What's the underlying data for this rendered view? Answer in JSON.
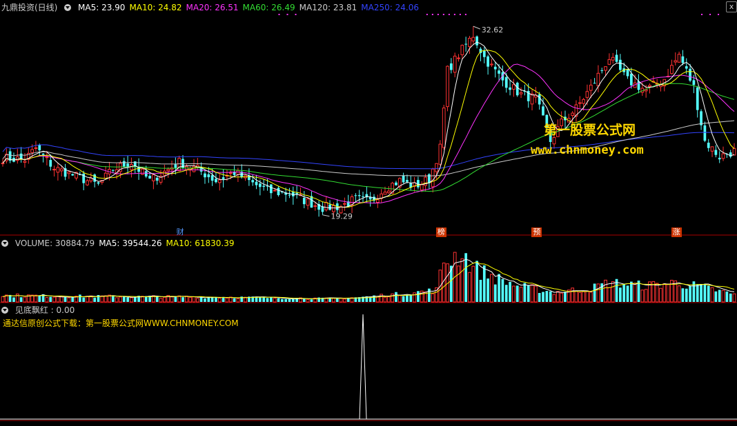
{
  "main_header": {
    "title": "九鼎投资(日线)",
    "ma_labels": [
      {
        "text": "MA5: 23.90",
        "color": "#ffffff"
      },
      {
        "text": "MA10: 24.82",
        "color": "#ffff00"
      },
      {
        "text": "MA20: 26.51",
        "color": "#ff33ff"
      },
      {
        "text": "MA60: 26.49",
        "color": "#33dd33"
      },
      {
        "text": "MA120: 23.81",
        "color": "#cccccc"
      },
      {
        "text": "MA250: 24.06",
        "color": "#3344ff"
      }
    ]
  },
  "volume_header": {
    "labels": [
      {
        "text": "VOLUME: 30884.79",
        "color": "#cccccc"
      },
      {
        "text": "MA5: 39544.26",
        "color": "#ffffff"
      },
      {
        "text": "MA10: 61830.39",
        "color": "#ffff00"
      }
    ]
  },
  "indicator_header": {
    "label": "见底飘红 : 0.00"
  },
  "indicator_note": "通达信原创公式下载：第一股票公式网WWW.CHNMONEY.COM",
  "watermark": {
    "line1": "第一股票公式网",
    "line2": "www.chnmoney.com"
  },
  "close_icon": "x",
  "events": [
    {
      "label": "财",
      "index": 48,
      "color": "#5599ff",
      "box": false
    },
    {
      "label": "榜",
      "index": 119,
      "color": "#ffffff",
      "box": true
    },
    {
      "label": "预",
      "index": 145,
      "color": "#ffffff",
      "box": true
    },
    {
      "label": "涨",
      "index": 183,
      "color": "#ffffff",
      "box": true
    }
  ],
  "colors": {
    "up": "#ff3333",
    "down": "#54ffff",
    "grid": "#aa0000",
    "ma5": "#ffffff",
    "ma10": "#ffff00",
    "ma20": "#ff33ff",
    "ma60": "#33dd33",
    "ma120": "#cccccc",
    "ma250": "#3344ff"
  },
  "chart_data": [
    {
      "type": "candlestick",
      "name": "price",
      "count": 200,
      "y_range": [
        18.4,
        33.6
      ],
      "max_label": "32.62",
      "min_label": "19.29",
      "max_value": 32.62,
      "min_value": 19.29,
      "anchors": [
        [
          0,
          23.3
        ],
        [
          6,
          23.2
        ],
        [
          9,
          24.0
        ],
        [
          14,
          22.6
        ],
        [
          20,
          22.0
        ],
        [
          26,
          21.4
        ],
        [
          30,
          22.5
        ],
        [
          35,
          23.0
        ],
        [
          40,
          21.7
        ],
        [
          45,
          22.5
        ],
        [
          48,
          23.0
        ],
        [
          53,
          22.5
        ],
        [
          58,
          21.7
        ],
        [
          63,
          22.3
        ],
        [
          68,
          21.5
        ],
        [
          73,
          20.9
        ],
        [
          78,
          20.8
        ],
        [
          83,
          20.2
        ],
        [
          87,
          19.8
        ],
        [
          92,
          19.9
        ],
        [
          96,
          20.4
        ],
        [
          100,
          20.2
        ],
        [
          104,
          21.2
        ],
        [
          108,
          21.7
        ],
        [
          112,
          21.3
        ],
        [
          116,
          21.8
        ],
        [
          119,
          24.0
        ],
        [
          121,
          29.5
        ],
        [
          124,
          30.6
        ],
        [
          128,
          32.0
        ],
        [
          131,
          30.4
        ],
        [
          136,
          28.8
        ],
        [
          141,
          27.8
        ],
        [
          145,
          27.5
        ],
        [
          149,
          24.5
        ],
        [
          152,
          25.8
        ],
        [
          156,
          26.8
        ],
        [
          160,
          28.3
        ],
        [
          165,
          30.4
        ],
        [
          170,
          28.8
        ],
        [
          175,
          28.1
        ],
        [
          180,
          28.9
        ],
        [
          184,
          30.6
        ],
        [
          188,
          28.3
        ],
        [
          191,
          24.5
        ],
        [
          195,
          23.4
        ],
        [
          199,
          23.8
        ]
      ]
    },
    {
      "type": "bar",
      "name": "volume",
      "anchors": [
        [
          0,
          12000
        ],
        [
          30,
          10000
        ],
        [
          60,
          9000
        ],
        [
          90,
          6000
        ],
        [
          100,
          10000
        ],
        [
          110,
          16000
        ],
        [
          118,
          22000
        ],
        [
          120,
          75000
        ],
        [
          125,
          92000
        ],
        [
          128,
          64000
        ],
        [
          135,
          42000
        ],
        [
          140,
          30000
        ],
        [
          150,
          18000
        ],
        [
          160,
          25000
        ],
        [
          165,
          36000
        ],
        [
          175,
          30000
        ],
        [
          183,
          36000
        ],
        [
          190,
          28000
        ],
        [
          199,
          14000
        ]
      ],
      "y_max": 100000
    },
    {
      "type": "line",
      "name": "见底飘红",
      "spike_index": 98,
      "spike_value": 1,
      "y_range": [
        0,
        1
      ]
    }
  ]
}
